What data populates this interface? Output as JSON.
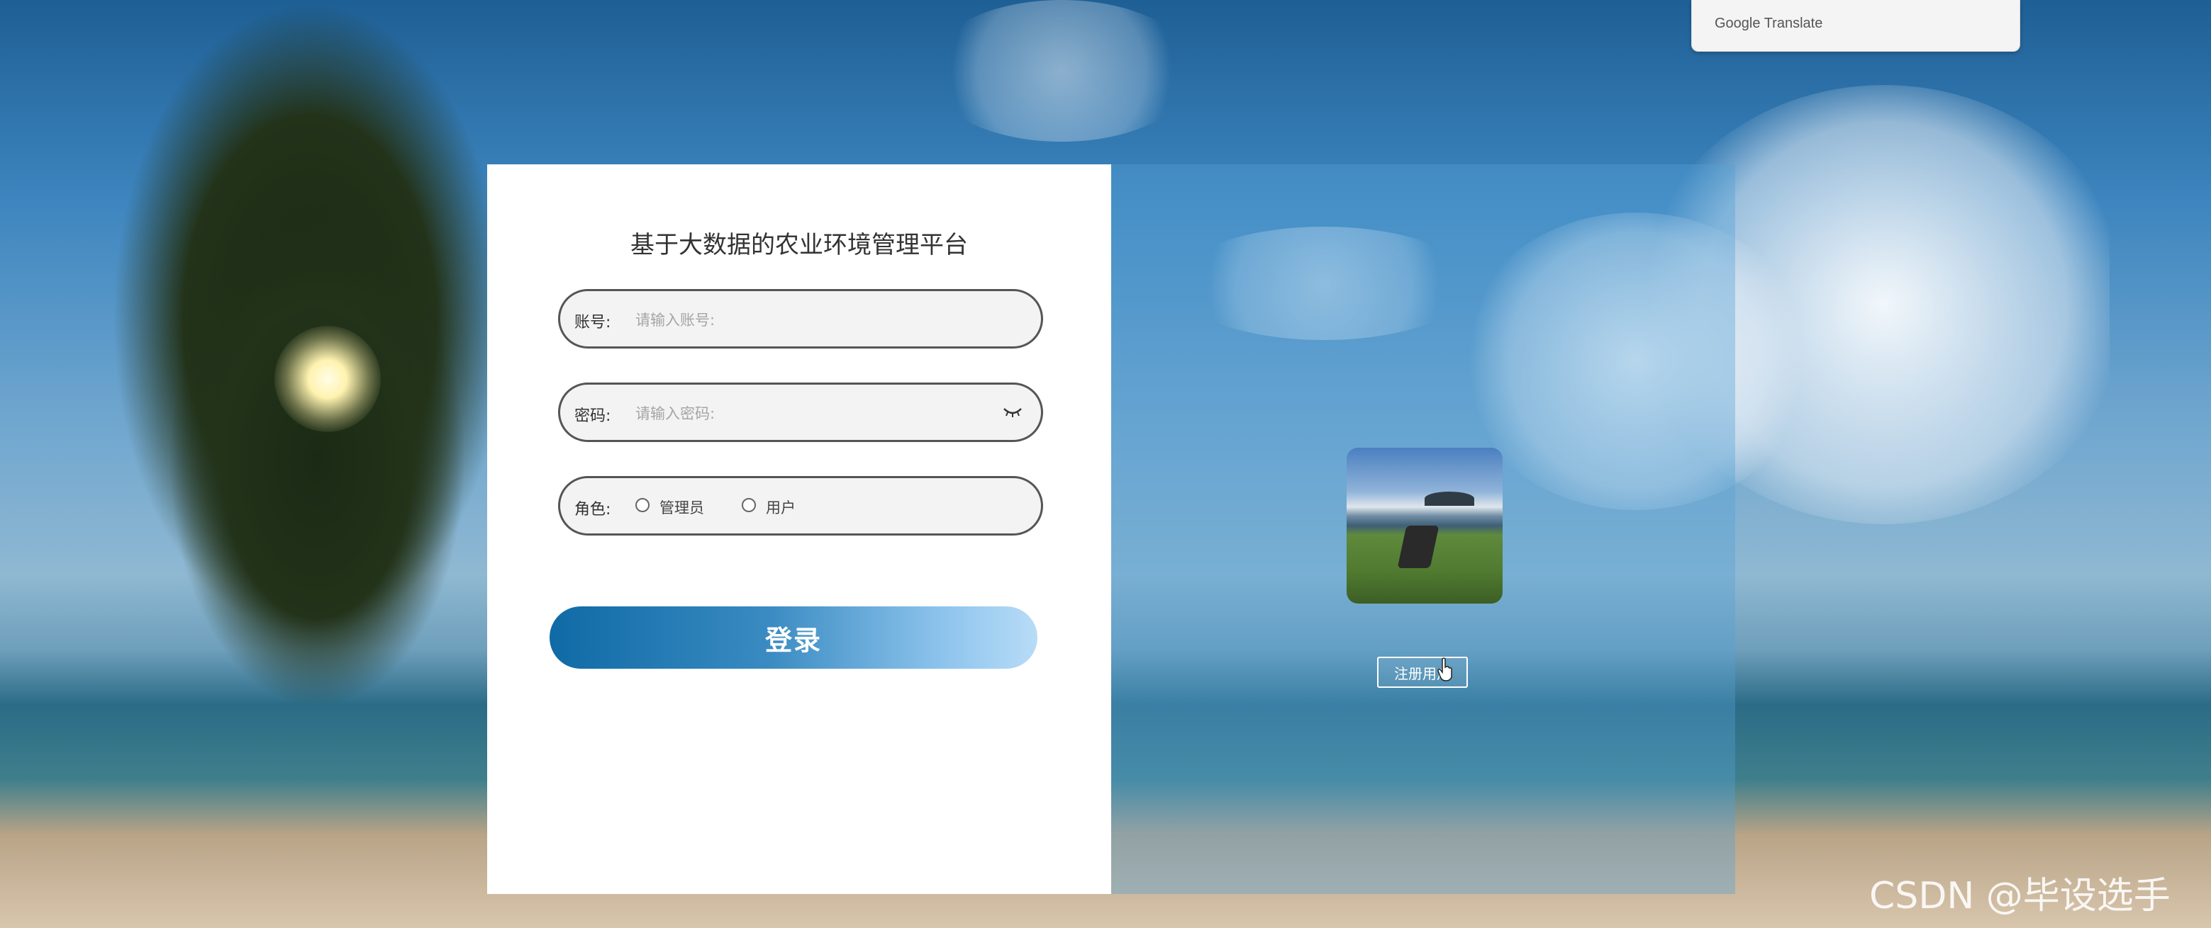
{
  "translate_widget": {
    "label": "Google Translate"
  },
  "login_form": {
    "title": "基于大数据的农业环境管理平台",
    "account": {
      "label": "账号:",
      "placeholder": "请输入账号:"
    },
    "password": {
      "label": "密码:",
      "placeholder": "请输入密码:"
    },
    "role": {
      "label": "角色:",
      "options": [
        "管理员",
        "用户"
      ]
    },
    "login_label": "登录"
  },
  "side_panel": {
    "register_label": "注册用户"
  },
  "watermark": "CSDN @毕设选手",
  "colors": {
    "login_gradient_start": "#0f6aa5",
    "login_gradient_end": "#b8dcf7",
    "panel_tint": "#54a0d6"
  }
}
